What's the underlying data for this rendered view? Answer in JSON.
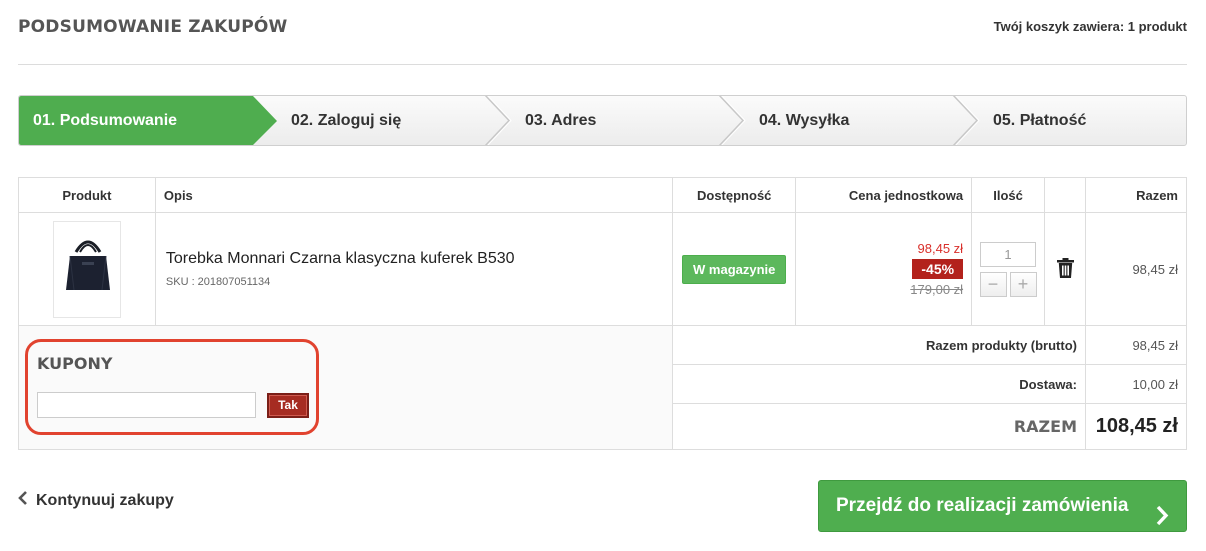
{
  "page": {
    "title": "PODSUMOWANIE ZAKUPÓW",
    "cart_count": "Twój koszyk zawiera: 1 produkt"
  },
  "steps": [
    {
      "label": "01. Podsumowanie",
      "active": true
    },
    {
      "label": "02. Zaloguj się",
      "active": false
    },
    {
      "label": "03. Adres",
      "active": false
    },
    {
      "label": "04. Wysyłka",
      "active": false
    },
    {
      "label": "05. Płatność",
      "active": false
    }
  ],
  "table": {
    "headers": {
      "product": "Produkt",
      "description": "Opis",
      "availability": "Dostępność",
      "unit_price": "Cena jednostkowa",
      "quantity": "Ilość",
      "total": "Razem"
    },
    "item": {
      "name": "Torebka Monnari Czarna klasyczna kuferek B530",
      "sku": "SKU : 201807051134",
      "availability": "W magazynie",
      "price_new": "98,45 zł",
      "discount": "-45%",
      "price_old": "179,00 zł",
      "quantity": "1",
      "qty_minus": "−",
      "qty_plus": "+",
      "total": "98,45 zł",
      "delete_icon": "trash-icon"
    }
  },
  "coupons": {
    "title": "KUPONY",
    "input_value": "",
    "submit_label": "Tak"
  },
  "summary": {
    "products_label": "Razem produkty (brutto)",
    "products_value": "98,45 zł",
    "shipping_label": "Dostawa:",
    "shipping_value": "10,00 zł",
    "total_label": "RAZEM",
    "total_value": "108,45 zł"
  },
  "actions": {
    "continue_label": "Kontynuuj zakupy",
    "checkout_label": "Przejdź do realizacji zamówienia"
  },
  "colors": {
    "accent_green": "#4fad4f",
    "discount_red": "#b3221c",
    "price_red": "#d9302b",
    "highlight_frame": "#e1432f"
  }
}
